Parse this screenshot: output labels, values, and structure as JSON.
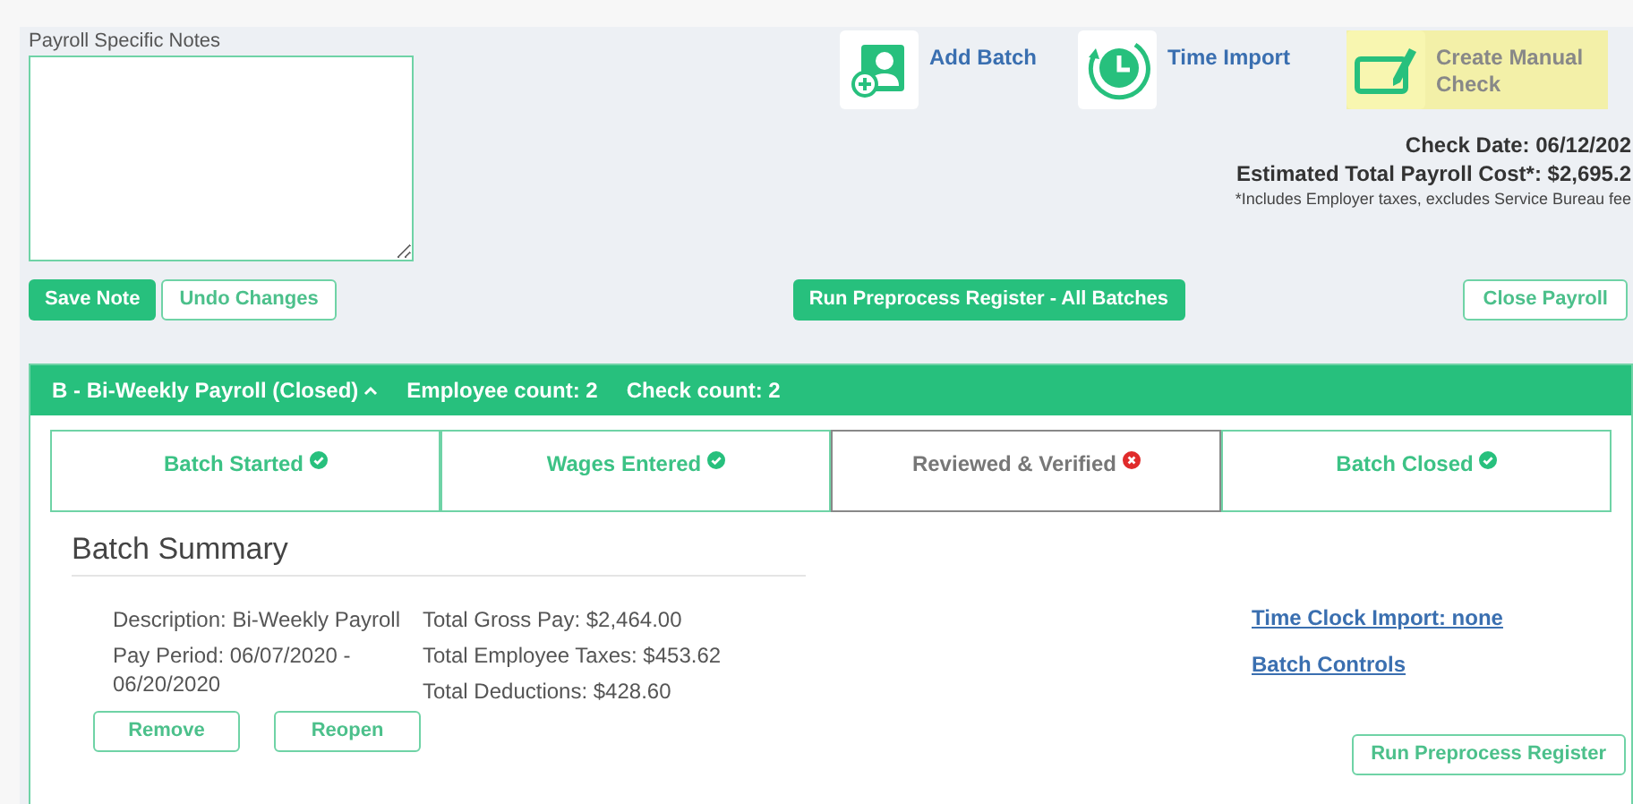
{
  "notes": {
    "label": "Payroll Specific Notes"
  },
  "note_buttons": [
    {
      "label": "Save Note",
      "kind": "primary"
    },
    {
      "label": "Undo Changes",
      "kind": "outline"
    }
  ],
  "actions": [
    {
      "label": "Add Batch",
      "kind": "add-batch",
      "highlighted": false
    },
    {
      "label": "Time Import",
      "kind": "time-import",
      "highlighted": false
    },
    {
      "label": "Create Manual Check",
      "kind": "manual-check",
      "highlighted": true
    }
  ],
  "summary": {
    "check_date": "Check Date: 06/12/202",
    "total_cost": "Estimated Total Payroll Cost*: $2,695.2",
    "footnote": "*Includes Employer taxes, excludes Service Bureau fee"
  },
  "run_all_button": "Run Preprocess Register - All Batches",
  "close_button": "Close Payroll",
  "batch": {
    "title": "B - Bi-Weekly Payroll (Closed)",
    "expanded": true,
    "employee_count": "Employee count: 2",
    "check_count": "Check count: 2",
    "steps": [
      {
        "label": "Batch Started",
        "done": true
      },
      {
        "label": "Wages Entered",
        "done": true
      },
      {
        "label": "Reviewed & Verified",
        "done": false
      },
      {
        "label": "Batch Closed",
        "done": true
      }
    ],
    "summary_title": "Batch Summary",
    "details_left": [
      "Description: Bi-Weekly Payroll",
      "Pay Period: 06/07/2020 - 06/20/2020"
    ],
    "details_right": [
      "Total Gross Pay: $2,464.00",
      "Total Employee Taxes: $453.62",
      "Total Deductions: $428.60"
    ],
    "links": [
      "Time Clock Import: none",
      "Batch Controls"
    ],
    "buttons": [
      "Remove",
      "Reopen"
    ],
    "run_button": "Run Preprocess Register"
  }
}
